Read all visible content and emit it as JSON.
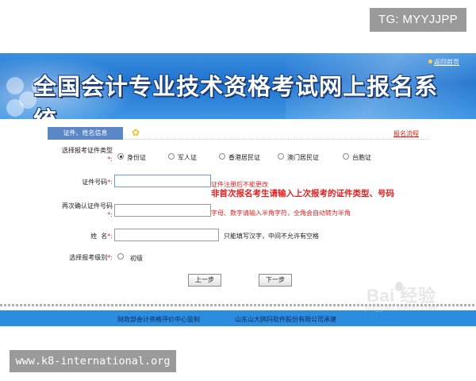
{
  "overlays": {
    "tag": "TG: MYYJJPP",
    "site": "www.k8-international.org"
  },
  "header": {
    "title": "全国会计专业技术资格考试网上报名系统",
    "return_link": "返回首页"
  },
  "section": {
    "tab_label": "证件、姓名信息",
    "flow_link": "报名流程"
  },
  "form": {
    "id_type": {
      "label": "选择报考证件类型",
      "required_mark": "*:",
      "options": [
        {
          "label": "身份证",
          "checked": true
        },
        {
          "label": "军人证",
          "checked": false
        },
        {
          "label": "香港居民证",
          "checked": false
        },
        {
          "label": "澳门居民证",
          "checked": false
        },
        {
          "label": "台胞证",
          "checked": false
        }
      ]
    },
    "id_number": {
      "label": "证件号码",
      "required_mark": "*:",
      "value": "",
      "note_small": "证件注册后不能更改",
      "note_big": "非首次报名考生请输入上次报考的证件类型、号码"
    },
    "id_confirm": {
      "label": "再次确认证件号码",
      "required_mark": "*:",
      "value": "",
      "note": "字母、数字请输入半角字符，全角会自动转为半角"
    },
    "name": {
      "label": "姓  名",
      "required_mark": "*:",
      "value": "",
      "note": "只能填写汉字，中间不允许有空格"
    },
    "level": {
      "label": "选择报考级别",
      "required_mark": "*:",
      "options": [
        {
          "label": "初级",
          "checked": false
        }
      ]
    },
    "buttons": {
      "prev": "上一步",
      "next": "下一步"
    }
  },
  "footer": {
    "left": "财政部会计资格评价中心监制",
    "right": "山东山大鸥玛软件股份有限公司承建"
  },
  "watermark": {
    "brand": "Bai 经验",
    "url": "jingyan.baidu.com"
  },
  "colors": {
    "banner": "#1f73cf",
    "tab": "#5b86c8",
    "required": "#e02020",
    "footer": "#2c8ce0"
  }
}
